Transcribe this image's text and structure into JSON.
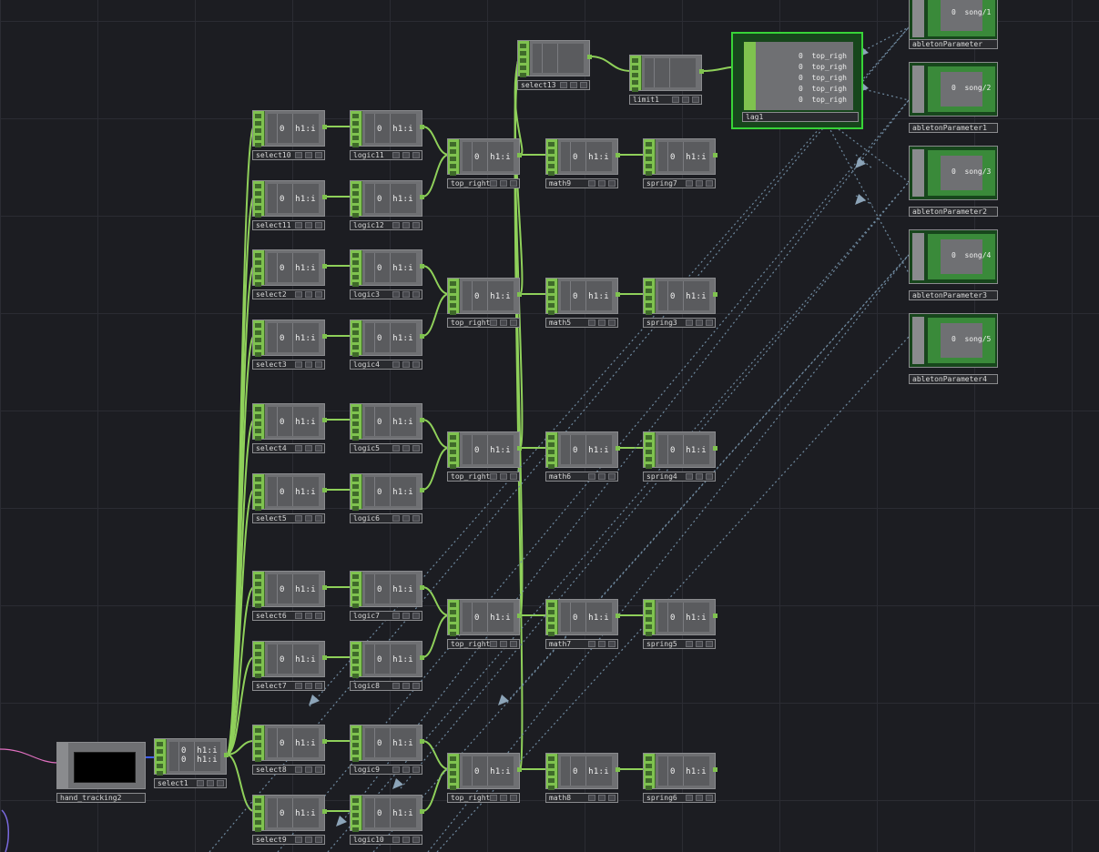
{
  "network": {
    "nodes": {
      "select10": {
        "label": "select10",
        "value": "0  h1:i"
      },
      "logic11": {
        "label": "logic11",
        "value": "0  h1:i"
      },
      "select11": {
        "label": "select11",
        "value": "0  h1:i"
      },
      "logic12": {
        "label": "logic12",
        "value": "0  h1:i"
      },
      "select2": {
        "label": "select2",
        "value": "0  h1:i"
      },
      "logic3": {
        "label": "logic3",
        "value": "0  h1:i"
      },
      "select3": {
        "label": "select3",
        "value": "0  h1:i"
      },
      "logic4": {
        "label": "logic4",
        "value": "0  h1:i"
      },
      "select4": {
        "label": "select4",
        "value": "0  h1:i"
      },
      "logic5": {
        "label": "logic5",
        "value": "0  h1:i"
      },
      "select5": {
        "label": "select5",
        "value": "0  h1:i"
      },
      "logic6": {
        "label": "logic6",
        "value": "0  h1:i"
      },
      "select6": {
        "label": "select6",
        "value": "0  h1:i"
      },
      "logic7": {
        "label": "logic7",
        "value": "0  h1:i"
      },
      "select7": {
        "label": "select7",
        "value": "0  h1:i"
      },
      "logic8": {
        "label": "logic8",
        "value": "0  h1:i"
      },
      "select8": {
        "label": "select8",
        "value": "0  h1:i"
      },
      "logic9": {
        "label": "logic9",
        "value": "0  h1:i"
      },
      "select9": {
        "label": "select9",
        "value": "0  h1:i"
      },
      "logic10": {
        "label": "logic10",
        "value": "0  h1:i"
      },
      "top_right4": {
        "label": "top_right4",
        "value": "0  h1:i"
      },
      "top_right1": {
        "label": "top_right",
        "value": "0  h1:i"
      },
      "top_right_a": {
        "label": "top_right1",
        "value": "0  h1:i"
      },
      "top_right2": {
        "label": "top_right2",
        "value": "0  h1:i"
      },
      "top_right3": {
        "label": "top_right3",
        "value": "0  h1:i"
      },
      "math9": {
        "label": "math9",
        "value": "0  h1:i"
      },
      "math5": {
        "label": "math5",
        "value": "0  h1:i"
      },
      "math6": {
        "label": "math6",
        "value": "0  h1:i"
      },
      "math7": {
        "label": "math7",
        "value": "0  h1:i"
      },
      "math8": {
        "label": "math8",
        "value": "0  h1:i"
      },
      "spring7": {
        "label": "spring7",
        "value": "0  h1:i"
      },
      "spring3": {
        "label": "spring3",
        "value": "0  h1:i"
      },
      "spring4": {
        "label": "spring4",
        "value": "0  h1:i"
      },
      "spring5": {
        "label": "spring5",
        "value": "0  h1:i"
      },
      "spring6": {
        "label": "spring6",
        "value": "0  h1:i"
      },
      "select13": {
        "label": "select13",
        "value": ""
      },
      "limit1": {
        "label": "limit1",
        "value": ""
      },
      "select1": {
        "label": "select1",
        "value": "0  h1:i\n0  h1:i"
      }
    },
    "lag1": {
      "label": "lag1",
      "channels": [
        "0  top_righ",
        "0  top_righ",
        "0  top_righ",
        "0  top_righ",
        "0  top_righ"
      ]
    },
    "hand_tracking": {
      "label": "hand_tracking2"
    },
    "ableton": [
      {
        "label": "abletonParameter",
        "value": "0  song/1"
      },
      {
        "label": "abletonParameter1",
        "value": "0  song/2"
      },
      {
        "label": "abletonParameter2",
        "value": "0  song/3"
      },
      {
        "label": "abletonParameter3",
        "value": "0  song/4"
      },
      {
        "label": "abletonParameter4",
        "value": "0  song/5"
      }
    ]
  },
  "colors": {
    "background": "#1c1d22",
    "chop_green": "#7fc24f",
    "wire": "#8fd05a",
    "export_line": "#6f8aa0",
    "selected": "#38d438"
  }
}
